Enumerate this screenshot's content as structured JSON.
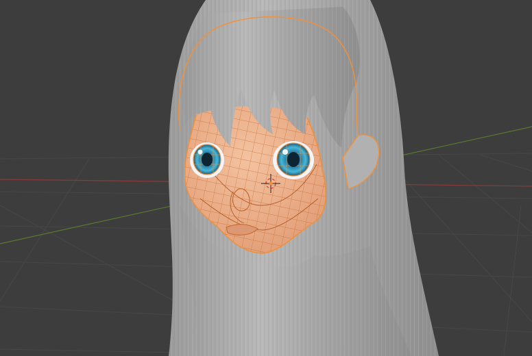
{
  "viewport": {
    "background_color": "#3d3d3d",
    "grid_color": "#474747",
    "x_axis_color": "#8a3b3b",
    "y_axis_color": "#5b7a2e",
    "selection_color": "#f2903a",
    "hair_color": "#a9a9a9",
    "skin_color": "#e9a982",
    "iris_color": "#2e8db4"
  },
  "objects": [
    {
      "name": "Hair",
      "selected": false
    },
    {
      "name": "Face",
      "selected": true
    },
    {
      "name": "Eyes",
      "selected": true
    }
  ],
  "cursor": {
    "icon": "3d-cursor-icon"
  }
}
